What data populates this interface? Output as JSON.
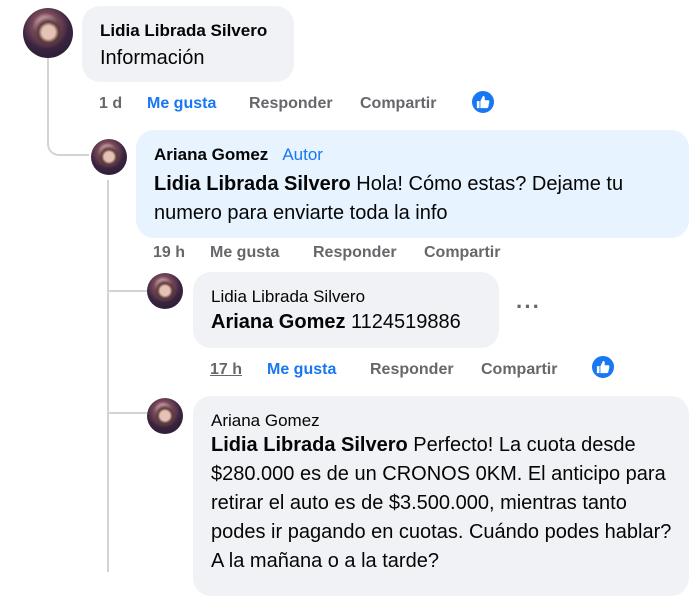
{
  "comments": [
    {
      "author": "Lidia Librada Silvero",
      "text": "Información",
      "time": "1 d",
      "like": "Me gusta",
      "reply": "Responder",
      "share": "Compartir"
    },
    {
      "author": "Ariana Gomez",
      "badge": "Autor",
      "mention": "Lidia Librada Silvero",
      "text": " Hola! Cómo estas? Dejame tu numero para enviarte toda la info",
      "time": "19 h",
      "like": "Me gusta",
      "reply": "Responder",
      "share": "Compartir"
    },
    {
      "author": "Lidia Librada Silvero",
      "mention": "Ariana Gomez",
      "text": " 1124519886",
      "time": "17 h",
      "like": "Me gusta",
      "reply": "Responder",
      "share": "Compartir",
      "more": "···"
    },
    {
      "author": "Ariana Gomez",
      "mention": "Lidia Librada Silvero",
      "text": " Perfecto! La cuota desde $280.000 es de un CRONOS 0KM. El anticipo para retirar el auto es de $3.500.000, mientras tanto podes ir pagando en cuotas. Cuándo podes hablar? A la mañana o a la tarde?"
    }
  ],
  "colors": {
    "accent": "#1877f2",
    "bubble_gray": "#f0f2f5",
    "bubble_blue": "#e7f3ff",
    "meta": "#65676b"
  },
  "icons": {
    "reaction": "like-thumb-icon"
  }
}
